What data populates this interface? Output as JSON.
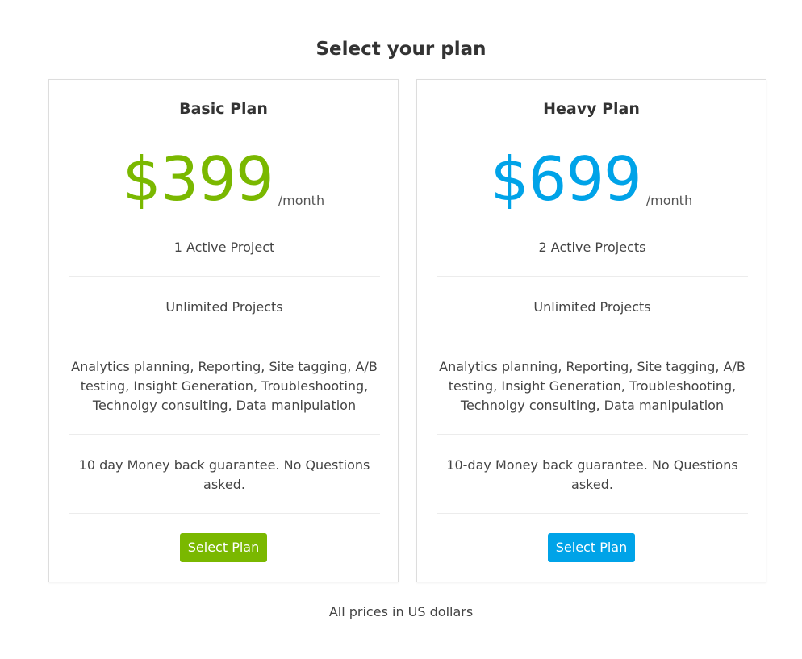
{
  "page": {
    "title": "Select your plan",
    "footnote": "All prices in US dollars"
  },
  "plans": [
    {
      "name": "Basic Plan",
      "price": "$399",
      "period": "/month",
      "accent_color": "#7ab800",
      "features": [
        "1 Active Project",
        "Unlimited Projects",
        "Analytics planning, Reporting, Site tagging, A/B testing, Insight Generation, Troubleshooting, Technolgy consulting, Data manipulation",
        "10 day Money back guarantee. No Questions asked."
      ],
      "button_label": "Select Plan"
    },
    {
      "name": "Heavy Plan",
      "price": "$699",
      "period": "/month",
      "accent_color": "#00a3e8",
      "features": [
        "2 Active Projects",
        "Unlimited Projects",
        "Analytics planning, Reporting, Site tagging, A/B testing, Insight Generation, Troubleshooting, Technolgy consulting, Data manipulation",
        "10-day Money back guarantee. No Questions asked."
      ],
      "button_label": "Select Plan"
    }
  ]
}
